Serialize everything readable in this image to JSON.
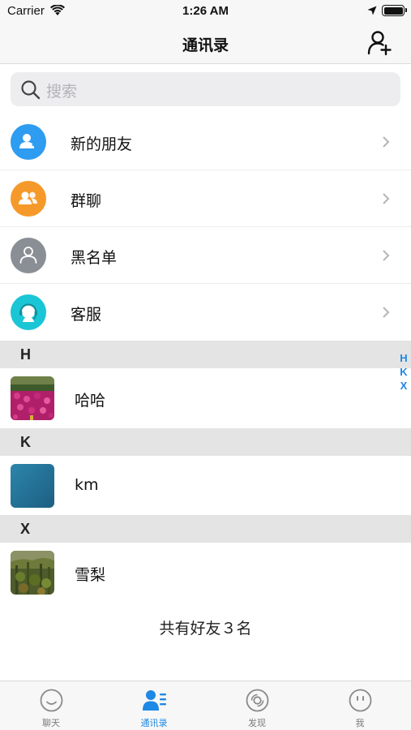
{
  "status_bar": {
    "carrier": "Carrier",
    "time": "1:26 AM"
  },
  "nav": {
    "title": "通讯录",
    "add_icon": "add-friend-icon"
  },
  "search": {
    "placeholder": "搜索"
  },
  "functions": [
    {
      "label": "新的朋友",
      "icon": "new-friend-icon",
      "color": "#2e9cf0"
    },
    {
      "label": "群聊",
      "icon": "group-chat-icon",
      "color": "#f59a2a"
    },
    {
      "label": "黑名单",
      "icon": "blacklist-icon",
      "color": "#8a8f96"
    },
    {
      "label": "客服",
      "icon": "customer-service-icon",
      "color": "#1ac6d6"
    }
  ],
  "sections": [
    {
      "letter": "H",
      "contacts": [
        {
          "name": "哈哈"
        }
      ]
    },
    {
      "letter": "K",
      "contacts": [
        {
          "name": "km"
        }
      ]
    },
    {
      "letter": "X",
      "contacts": [
        {
          "name": "雪梨"
        }
      ]
    }
  ],
  "index_letters": [
    "H",
    "K",
    "X"
  ],
  "footer": {
    "count_text": "共有好友３名"
  },
  "tabs": [
    {
      "label": "聊天",
      "icon": "chat-icon",
      "active": false
    },
    {
      "label": "通讯录",
      "icon": "contacts-icon",
      "active": true
    },
    {
      "label": "发现",
      "icon": "discover-icon",
      "active": false
    },
    {
      "label": "我",
      "icon": "me-icon",
      "active": false
    }
  ],
  "colors": {
    "accent": "#1e88e5",
    "section_bg": "#e4e4e4",
    "bar_bg": "#f7f7f7"
  }
}
